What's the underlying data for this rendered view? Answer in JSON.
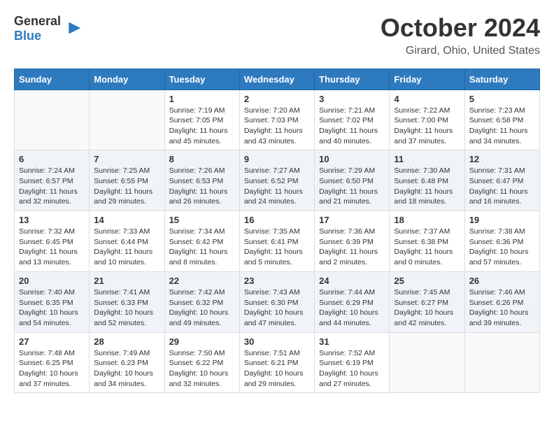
{
  "header": {
    "logo_general": "General",
    "logo_blue": "Blue",
    "month": "October 2024",
    "location": "Girard, Ohio, United States"
  },
  "weekdays": [
    "Sunday",
    "Monday",
    "Tuesday",
    "Wednesday",
    "Thursday",
    "Friday",
    "Saturday"
  ],
  "weeks": [
    [
      {
        "day": "",
        "content": ""
      },
      {
        "day": "",
        "content": ""
      },
      {
        "day": "1",
        "content": "Sunrise: 7:19 AM\nSunset: 7:05 PM\nDaylight: 11 hours and 45 minutes."
      },
      {
        "day": "2",
        "content": "Sunrise: 7:20 AM\nSunset: 7:03 PM\nDaylight: 11 hours and 43 minutes."
      },
      {
        "day": "3",
        "content": "Sunrise: 7:21 AM\nSunset: 7:02 PM\nDaylight: 11 hours and 40 minutes."
      },
      {
        "day": "4",
        "content": "Sunrise: 7:22 AM\nSunset: 7:00 PM\nDaylight: 11 hours and 37 minutes."
      },
      {
        "day": "5",
        "content": "Sunrise: 7:23 AM\nSunset: 6:58 PM\nDaylight: 11 hours and 34 minutes."
      }
    ],
    [
      {
        "day": "6",
        "content": "Sunrise: 7:24 AM\nSunset: 6:57 PM\nDaylight: 11 hours and 32 minutes."
      },
      {
        "day": "7",
        "content": "Sunrise: 7:25 AM\nSunset: 6:55 PM\nDaylight: 11 hours and 29 minutes."
      },
      {
        "day": "8",
        "content": "Sunrise: 7:26 AM\nSunset: 6:53 PM\nDaylight: 11 hours and 26 minutes."
      },
      {
        "day": "9",
        "content": "Sunrise: 7:27 AM\nSunset: 6:52 PM\nDaylight: 11 hours and 24 minutes."
      },
      {
        "day": "10",
        "content": "Sunrise: 7:29 AM\nSunset: 6:50 PM\nDaylight: 11 hours and 21 minutes."
      },
      {
        "day": "11",
        "content": "Sunrise: 7:30 AM\nSunset: 6:48 PM\nDaylight: 11 hours and 18 minutes."
      },
      {
        "day": "12",
        "content": "Sunrise: 7:31 AM\nSunset: 6:47 PM\nDaylight: 11 hours and 16 minutes."
      }
    ],
    [
      {
        "day": "13",
        "content": "Sunrise: 7:32 AM\nSunset: 6:45 PM\nDaylight: 11 hours and 13 minutes."
      },
      {
        "day": "14",
        "content": "Sunrise: 7:33 AM\nSunset: 6:44 PM\nDaylight: 11 hours and 10 minutes."
      },
      {
        "day": "15",
        "content": "Sunrise: 7:34 AM\nSunset: 6:42 PM\nDaylight: 11 hours and 8 minutes."
      },
      {
        "day": "16",
        "content": "Sunrise: 7:35 AM\nSunset: 6:41 PM\nDaylight: 11 hours and 5 minutes."
      },
      {
        "day": "17",
        "content": "Sunrise: 7:36 AM\nSunset: 6:39 PM\nDaylight: 11 hours and 2 minutes."
      },
      {
        "day": "18",
        "content": "Sunrise: 7:37 AM\nSunset: 6:38 PM\nDaylight: 11 hours and 0 minutes."
      },
      {
        "day": "19",
        "content": "Sunrise: 7:38 AM\nSunset: 6:36 PM\nDaylight: 10 hours and 57 minutes."
      }
    ],
    [
      {
        "day": "20",
        "content": "Sunrise: 7:40 AM\nSunset: 6:35 PM\nDaylight: 10 hours and 54 minutes."
      },
      {
        "day": "21",
        "content": "Sunrise: 7:41 AM\nSunset: 6:33 PM\nDaylight: 10 hours and 52 minutes."
      },
      {
        "day": "22",
        "content": "Sunrise: 7:42 AM\nSunset: 6:32 PM\nDaylight: 10 hours and 49 minutes."
      },
      {
        "day": "23",
        "content": "Sunrise: 7:43 AM\nSunset: 6:30 PM\nDaylight: 10 hours and 47 minutes."
      },
      {
        "day": "24",
        "content": "Sunrise: 7:44 AM\nSunset: 6:29 PM\nDaylight: 10 hours and 44 minutes."
      },
      {
        "day": "25",
        "content": "Sunrise: 7:45 AM\nSunset: 6:27 PM\nDaylight: 10 hours and 42 minutes."
      },
      {
        "day": "26",
        "content": "Sunrise: 7:46 AM\nSunset: 6:26 PM\nDaylight: 10 hours and 39 minutes."
      }
    ],
    [
      {
        "day": "27",
        "content": "Sunrise: 7:48 AM\nSunset: 6:25 PM\nDaylight: 10 hours and 37 minutes."
      },
      {
        "day": "28",
        "content": "Sunrise: 7:49 AM\nSunset: 6:23 PM\nDaylight: 10 hours and 34 minutes."
      },
      {
        "day": "29",
        "content": "Sunrise: 7:50 AM\nSunset: 6:22 PM\nDaylight: 10 hours and 32 minutes."
      },
      {
        "day": "30",
        "content": "Sunrise: 7:51 AM\nSunset: 6:21 PM\nDaylight: 10 hours and 29 minutes."
      },
      {
        "day": "31",
        "content": "Sunrise: 7:52 AM\nSunset: 6:19 PM\nDaylight: 10 hours and 27 minutes."
      },
      {
        "day": "",
        "content": ""
      },
      {
        "day": "",
        "content": ""
      }
    ]
  ]
}
